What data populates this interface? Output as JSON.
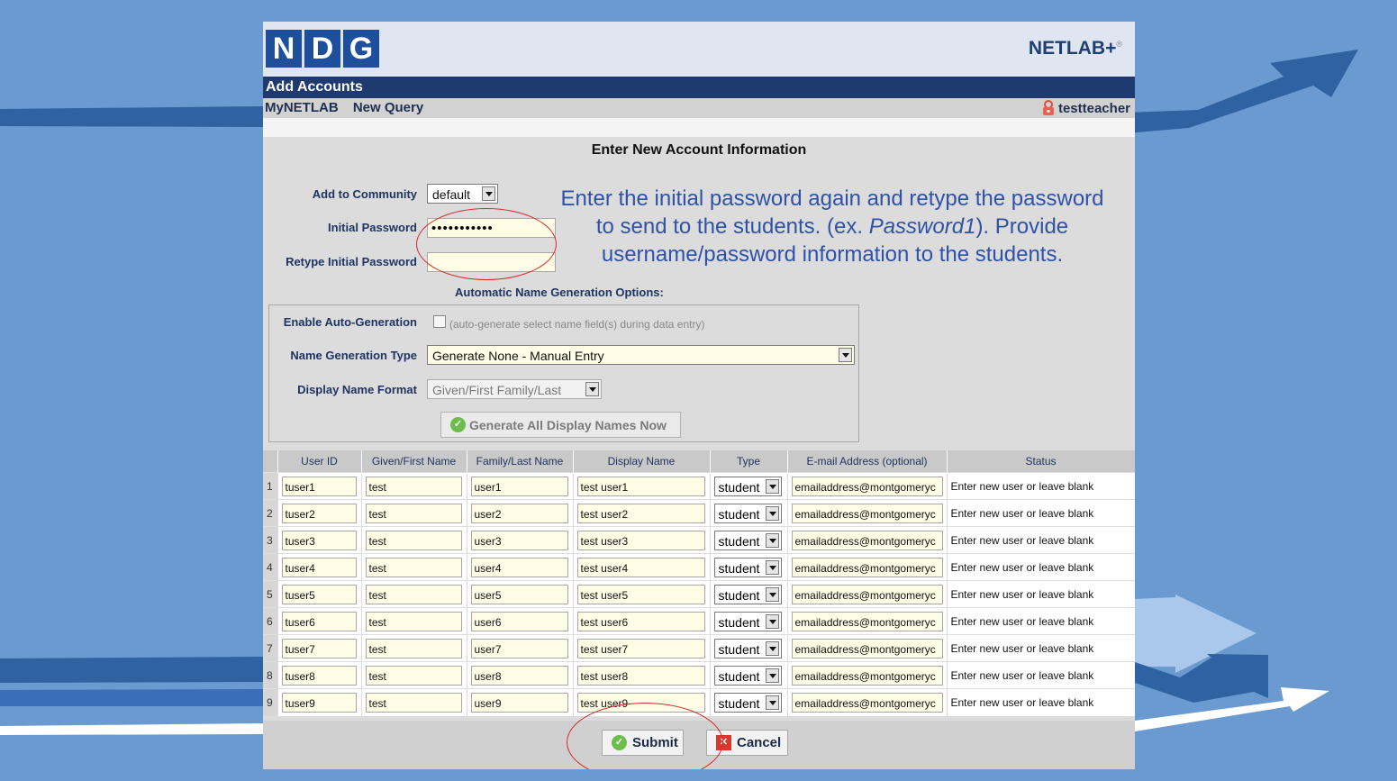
{
  "header": {
    "logo_letters": [
      "N",
      "D",
      "G"
    ],
    "brand": "NETLAB+",
    "brand_mark": "®"
  },
  "titlebar": {
    "title": "Add Accounts"
  },
  "nav": {
    "items": [
      "MyNETLAB",
      "New Query"
    ],
    "user": "testteacher"
  },
  "form": {
    "section_title": "Enter New Account Information",
    "community_label": "Add to Community",
    "community_value": "default",
    "initial_password_label": "Initial Password",
    "initial_password_value": "•••••••••••",
    "retype_label": "Retype Initial Password",
    "retype_value": ""
  },
  "annotation": {
    "line1": "Enter the initial password again and retype the password",
    "line2_pre": "to send to the students. (ex. ",
    "line2_em": "Password1",
    "line2_post": "). Provide",
    "line3": "username/password information to the students."
  },
  "options": {
    "title": "Automatic Name Generation Options:",
    "auto_label": "Enable Auto-Generation",
    "auto_text": "(auto-generate select name field(s) during data entry)",
    "type_label": "Name Generation Type",
    "type_value": "Generate None - Manual Entry",
    "format_label": "Display Name Format",
    "format_value": "Given/First Family/Last",
    "generate_button": "Generate All Display Names Now"
  },
  "table": {
    "headers": [
      "User ID",
      "Given/First Name",
      "Family/Last Name",
      "Display Name",
      "Type",
      "E-mail Address (optional)",
      "Status"
    ],
    "rows": [
      {
        "num": "1",
        "user_id": "tuser1",
        "given": "test",
        "family": "user1",
        "display": "test user1",
        "type": "student",
        "email": "emailaddress@montgomeryc",
        "status": "Enter new user or leave blank"
      },
      {
        "num": "2",
        "user_id": "tuser2",
        "given": "test",
        "family": "user2",
        "display": "test user2",
        "type": "student",
        "email": "emailaddress@montgomeryc",
        "status": "Enter new user or leave blank"
      },
      {
        "num": "3",
        "user_id": "tuser3",
        "given": "test",
        "family": "user3",
        "display": "test user3",
        "type": "student",
        "email": "emailaddress@montgomeryc",
        "status": "Enter new user or leave blank"
      },
      {
        "num": "4",
        "user_id": "tuser4",
        "given": "test",
        "family": "user4",
        "display": "test user4",
        "type": "student",
        "email": "emailaddress@montgomeryc",
        "status": "Enter new user or leave blank"
      },
      {
        "num": "5",
        "user_id": "tuser5",
        "given": "test",
        "family": "user5",
        "display": "test user5",
        "type": "student",
        "email": "emailaddress@montgomeryc",
        "status": "Enter new user or leave blank"
      },
      {
        "num": "6",
        "user_id": "tuser6",
        "given": "test",
        "family": "user6",
        "display": "test user6",
        "type": "student",
        "email": "emailaddress@montgomeryc",
        "status": "Enter new user or leave blank"
      },
      {
        "num": "7",
        "user_id": "tuser7",
        "given": "test",
        "family": "user7",
        "display": "test user7",
        "type": "student",
        "email": "emailaddress@montgomeryc",
        "status": "Enter new user or leave blank"
      },
      {
        "num": "8",
        "user_id": "tuser8",
        "given": "test",
        "family": "user8",
        "display": "test user8",
        "type": "student",
        "email": "emailaddress@montgomeryc",
        "status": "Enter new user or leave blank"
      },
      {
        "num": "9",
        "user_id": "tuser9",
        "given": "test",
        "family": "user9",
        "display": "test user9",
        "type": "student",
        "email": "emailaddress@montgomeryc",
        "status": "Enter new user or leave blank"
      }
    ]
  },
  "footer": {
    "submit": "Submit",
    "cancel": "Cancel"
  },
  "colors": {
    "background": "#6a9ad0",
    "navy": "#1e3a6e",
    "annotation": "#2d52a8",
    "highlight_ring": "#d8262b"
  }
}
